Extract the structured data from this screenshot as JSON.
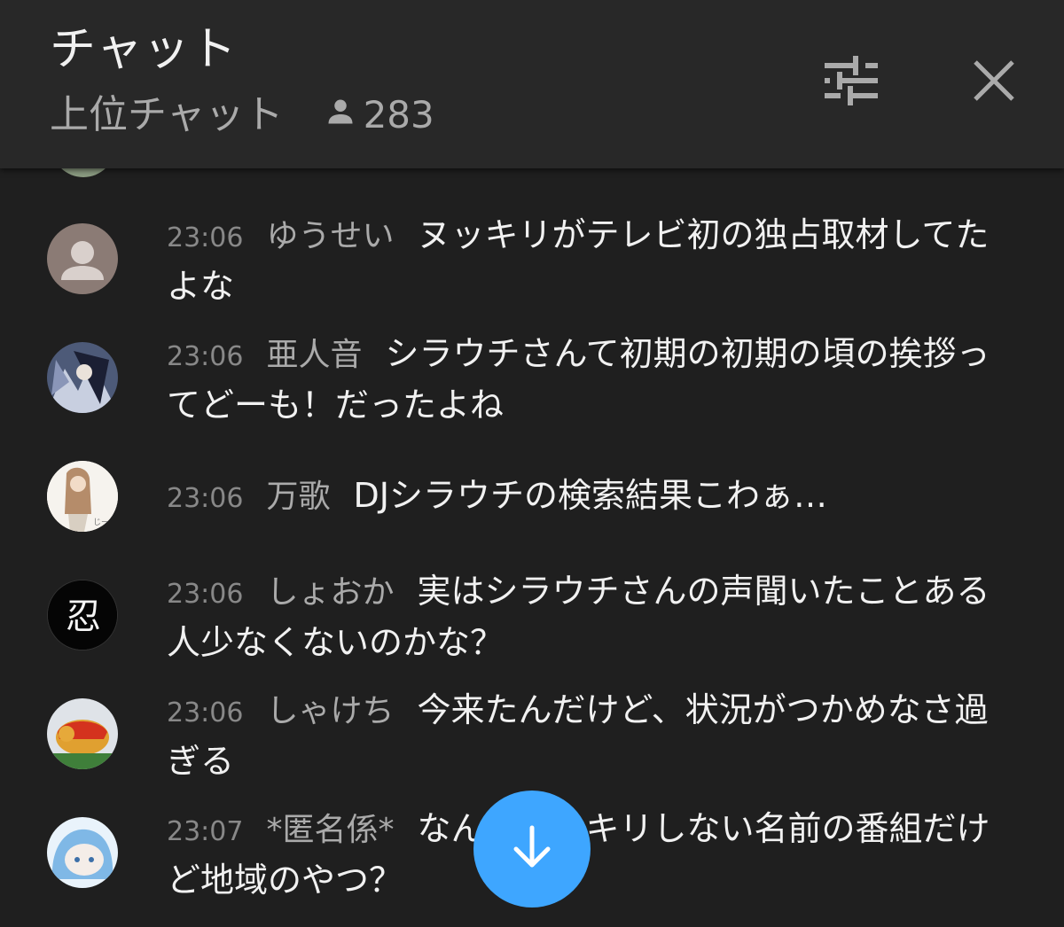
{
  "header": {
    "title": "チャット",
    "mode_label": "上位チャット",
    "viewer_count": "283",
    "icons": {
      "viewers": "person-icon",
      "filter": "sliders-icon",
      "close": "close-icon"
    }
  },
  "messages": [
    {
      "time": "23:06",
      "author": "ゆうせい",
      "text": "ヌッキリがテレビ初の独占取材してたよな",
      "avatar": "default-avatar-icon"
    },
    {
      "time": "23:06",
      "author": "亜人音",
      "text": "シラウチさんて初期の初期の頃の挨拶ってどーも！だったよね",
      "avatar": "anime-avatar"
    },
    {
      "time": "23:06",
      "author": "万歌",
      "text": "DJシラウチの検索結果こわぁ…",
      "avatar": "illustration-avatar"
    },
    {
      "time": "23:06",
      "author": "しょおか",
      "text": "実はシラウチさんの声聞いたことある人少なくないのかな？",
      "avatar": "kanji-avatar"
    },
    {
      "time": "23:06",
      "author": "しゃけち",
      "text": "今来たんだけど、状況がつかめなさ過ぎる",
      "avatar": "figure-avatar"
    },
    {
      "time": "23:07",
      "author": "*匿名係*",
      "text": "なんかスッキリしない名前の番組だけど地域のやつ？",
      "avatar": "blue-character-avatar"
    }
  ],
  "avatar_kanji": "忍",
  "fab": {
    "icon": "arrow-down-icon"
  },
  "colors": {
    "background": "#1f1f1f",
    "header": "#282828",
    "accent": "#3ea6ff",
    "author": "#aaaaaa",
    "timestamp": "#888888"
  }
}
